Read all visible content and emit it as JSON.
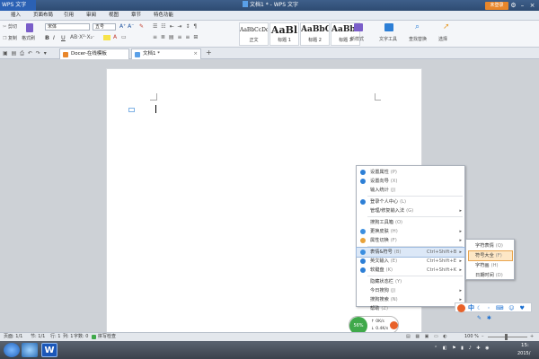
{
  "app": {
    "logo_text": "WPS 文字",
    "window_title": "文档1 * - WPS 文字",
    "login_label": "未登录"
  },
  "menubar": [
    "插入",
    "页面布局",
    "引用",
    "审阅",
    "视图",
    "章节",
    "特色功能"
  ],
  "ribbon": {
    "cut": "剪切",
    "copy": "复制",
    "format_painter": "格式刷",
    "font_name": "宋体",
    "font_size": "五号",
    "bold": "B",
    "italic": "I",
    "underline": "U",
    "styles": [
      {
        "sample": "AaBbCcDd",
        "name": "正文"
      },
      {
        "sample": "AaBl",
        "name": "标题 1"
      },
      {
        "sample": "AaBbC",
        "name": "标题 2"
      },
      {
        "sample": "AaBbC",
        "name": "标题 3"
      }
    ],
    "new_style": "新样式",
    "text_tools": "文字工具",
    "find_replace": "查找替换",
    "select": "选择"
  },
  "tabs": [
    {
      "label": "Docer-在线模板"
    },
    {
      "label": "文档1 *"
    }
  ],
  "context_menu": {
    "items": [
      {
        "label": "设置属性",
        "key": "(P)",
        "icon_color": "#2d7fd6"
      },
      {
        "label": "设置向导",
        "key": "(X)",
        "icon_color": "#2d7fd6"
      },
      {
        "label": "输入统计",
        "key": "(J)"
      },
      {
        "label": "登录个人中心",
        "key": "(L)",
        "icon_color": "#2d7fd6"
      },
      {
        "label": "管理/修复输入法",
        "key": "(G)",
        "arrow": true
      },
      {
        "label": "搜狗工具箱",
        "key": "(O)"
      },
      {
        "label": "更换皮肤",
        "key": "(H)",
        "arrow": true,
        "icon_color": "#3a8ee0"
      },
      {
        "label": "属性切换",
        "key": "(F)",
        "arrow": true,
        "icon_color": "#e8a23a"
      },
      {
        "label": "表情&符号",
        "key": "(B)",
        "shortcut": "Ctrl+Shift+B",
        "arrow": true,
        "highlighted": true,
        "icon_color": "#3a8ee0"
      },
      {
        "label": "英文输入",
        "key": "(E)",
        "shortcut": "Ctrl+Shift+E",
        "arrow": true,
        "icon_color": "#2d7fd6"
      },
      {
        "label": "软键盘",
        "key": "(K)",
        "shortcut": "Ctrl+Shift+K",
        "arrow": true,
        "icon_color": "#2d7fd6"
      },
      {
        "label": "隐藏状态栏",
        "key": "(Y)"
      },
      {
        "label": "今日搜狗",
        "key": "(J)",
        "arrow": true
      },
      {
        "label": "搜狗搜索",
        "key": "(N)",
        "arrow": true
      },
      {
        "label": "帮助",
        "key": "(Z)",
        "arrow": true
      }
    ]
  },
  "submenu": {
    "items": [
      {
        "label": "字符表情",
        "key": "(Q)"
      },
      {
        "label": "符号大全",
        "key": "(F)",
        "highlighted": true
      },
      {
        "label": "字符画",
        "key": "(H)"
      },
      {
        "label": "日期时间",
        "key": "(D)"
      }
    ]
  },
  "ime": {
    "mode": "中"
  },
  "statusbar": {
    "page": "页面: 1/1",
    "section": "节: 1/1",
    "row": "行: 1",
    "col": "列: 1",
    "word_count": "字数: 0",
    "spell_check": "拼写检查",
    "zoom": "100 %"
  },
  "speed_widget": {
    "percent": "56%",
    "up": "0K/s",
    "down": "0.4K/s"
  },
  "taskbar": {
    "clock_time": "15:",
    "clock_date": "2015/"
  },
  "colors": {
    "accent": "#2b61b4",
    "login_orange": "#e8862a",
    "highlight": "#dce8f7",
    "green": "#3fa94a"
  }
}
